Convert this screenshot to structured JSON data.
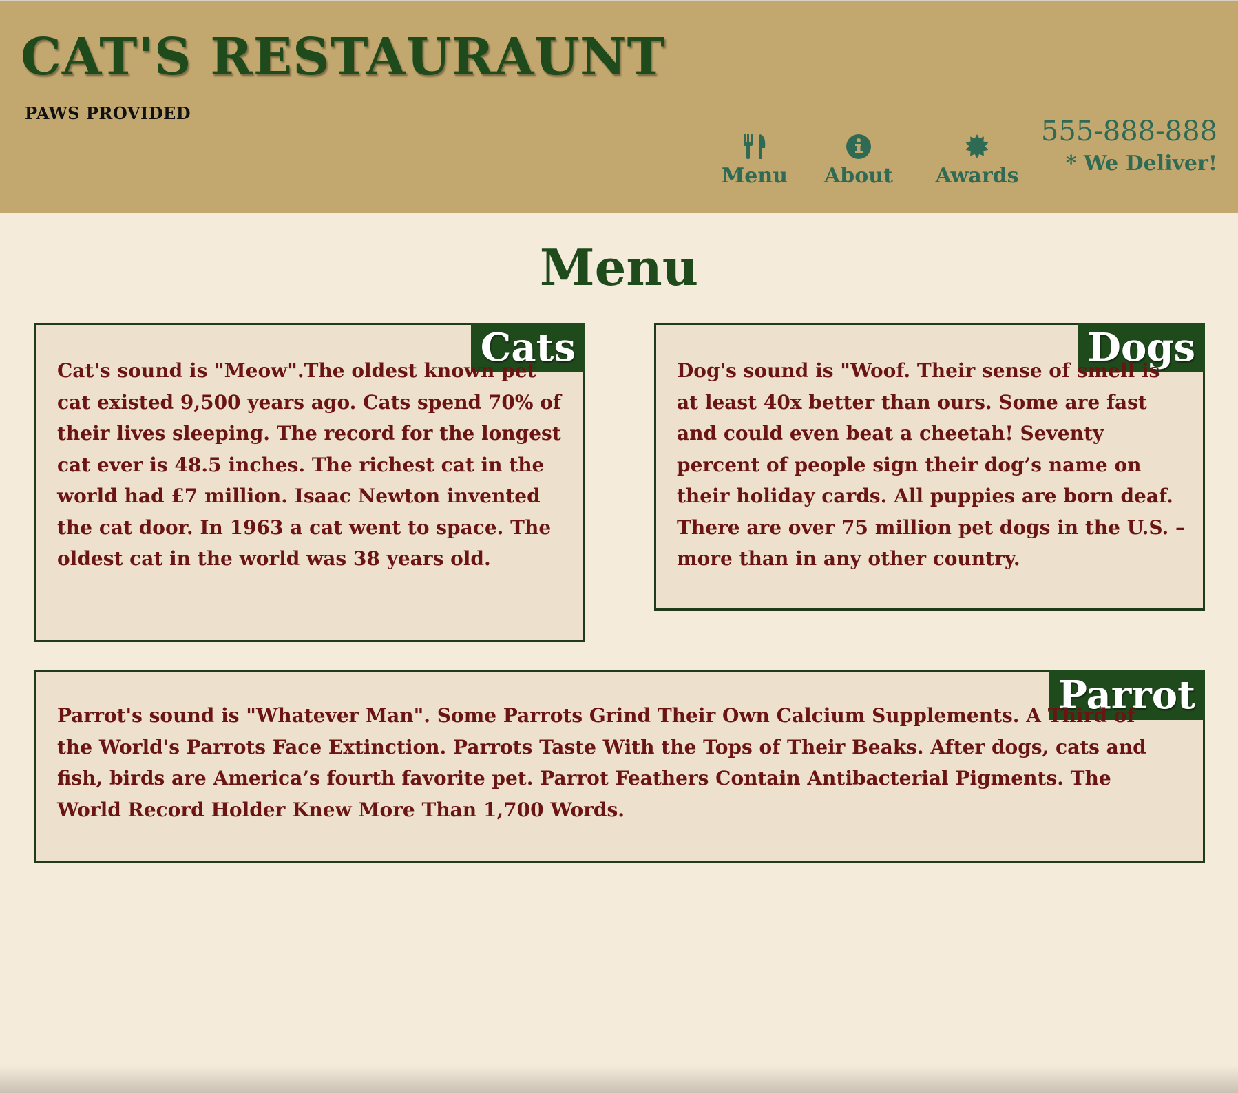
{
  "header": {
    "title": "CAT'S RESTAURAUNT",
    "tagline": "PAWS PROVIDED",
    "nav": [
      {
        "label": "Menu",
        "icon": "fork-knife-icon"
      },
      {
        "label": "About",
        "icon": "info-icon"
      },
      {
        "label": "Awards",
        "icon": "badge-icon"
      }
    ],
    "phone": "555-888-888",
    "deliver": "* We Deliver!"
  },
  "main": {
    "heading": "Menu",
    "cards": [
      {
        "tag": "Cats",
        "text": "Cat's sound is \"Meow\".The oldest known pet cat existed 9,500 years ago. Cats spend 70% of their lives sleeping. The record for the longest cat ever is 48.5 inches. The richest cat in the world had £7 million. Isaac Newton invented the cat door. In 1963 a cat went to space. The oldest cat in the world was 38 years old."
      },
      {
        "tag": "Dogs",
        "text": "Dog's sound is \"Woof. Their sense of smell is at least 40x better than ours. Some are fast and could even beat a cheetah! Seventy percent of people sign their dog’s name on their holiday cards. All puppies are born deaf. There are over 75 million pet dogs in the U.S. – more than in any other country."
      },
      {
        "tag": "Parrot",
        "text": "Parrot's sound is \"Whatever Man\". Some Parrots Grind Their Own Calcium Supplements. A Third of the World's Parrots Face Extinction. Parrots Taste With the Tops of Their Beaks. After dogs, cats and fish, birds are America’s fourth favorite pet. Parrot Feathers Contain Antibacterial Pigments. The World Record Holder Knew More Than 1,700 Words."
      }
    ]
  },
  "colors": {
    "header_bg": "#c2a76f",
    "page_bg": "#f5ebdb",
    "card_bg": "#ede0cc",
    "brand_green": "#1f4a1c",
    "nav_green": "#2f6a55",
    "body_text": "#6a1414"
  }
}
